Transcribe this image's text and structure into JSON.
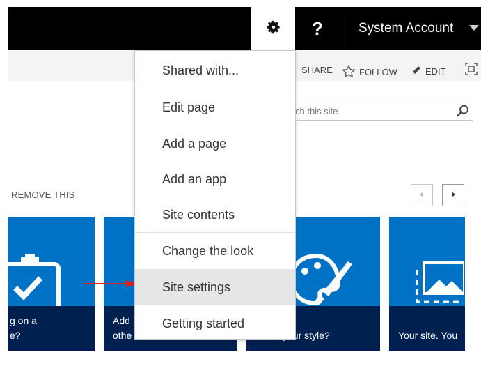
{
  "suite_bar": {
    "help_label": "?",
    "account_name": "System Account"
  },
  "ribbon": {
    "share_label": "SHARE",
    "follow_label": "FOLLOW",
    "edit_label": "EDIT"
  },
  "search": {
    "placeholder": "ch this site"
  },
  "promoted": {
    "remove_label": "REMOVE THIS"
  },
  "tiles": [
    {
      "line1": "g on a",
      "line2": "e?"
    },
    {
      "line1": "Add",
      "line2": "othe"
    },
    {
      "line1": "",
      "line2": "your style?"
    },
    {
      "line1": "",
      "line2": "Your site. You"
    }
  ],
  "settings_menu": {
    "items": [
      {
        "label": "Shared with..."
      },
      {
        "label": "Edit page"
      },
      {
        "label": "Add a page"
      },
      {
        "label": "Add an app"
      },
      {
        "label": "Site contents"
      },
      {
        "label": "Change the look"
      },
      {
        "label": "Site settings",
        "highlighted": true
      },
      {
        "label": "Getting started"
      }
    ]
  },
  "colors": {
    "suite_bar": "#000000",
    "tile_blue": "#0072c6",
    "tile_caption": "#002050",
    "arrow_red": "#e21b1b",
    "menu_highlight": "#e6e6e6"
  },
  "icons": [
    "gear-icon",
    "help-icon",
    "chevron-down-icon",
    "share-icon",
    "star-icon",
    "pencil-icon",
    "focus-icon",
    "search-icon",
    "chevron-left-icon",
    "chevron-right-icon",
    "clipboard-check-icon",
    "palette-icon",
    "picture-icon"
  ]
}
